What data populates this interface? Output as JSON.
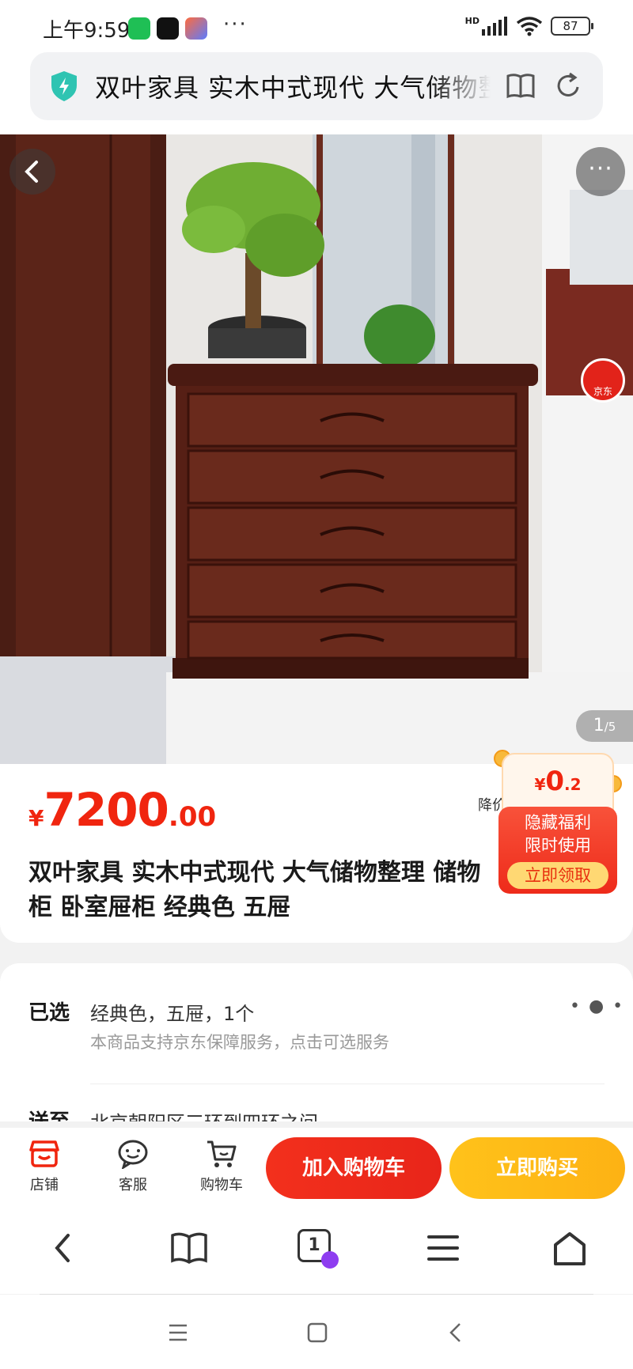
{
  "status_bar": {
    "time": "上午9:59",
    "dots": "···",
    "battery": "87",
    "network": "HD"
  },
  "url_bar": {
    "text": "双叶家具 实木中式现代 大气储物整理 储物柜 卧室屉柜 经典色 五屉"
  },
  "gallery": {
    "counter_current": "1",
    "counter_total": "/5",
    "jd_badge": "京东",
    "more_label": "···"
  },
  "product": {
    "currency": "¥",
    "price_int": "7200",
    "price_dec": ".00",
    "price_alert": "降价",
    "title": "双叶家具 实木中式现代 大气储物整理 储物柜 卧室屉柜 经典色 五屉"
  },
  "coupon": {
    "currency": "¥",
    "amount_int": "0",
    "amount_dec": ".2",
    "line1": "隐藏福利",
    "line2": "限时使用",
    "button": "立即领取"
  },
  "options": {
    "selected_label": "已选",
    "selected_value": "经典色，五屉，1个",
    "service_note": "本商品支持京东保障服务，点击可选服务",
    "ship_label": "送至",
    "ship_value": "北京朝阳区三环到四环之间"
  },
  "action_bar": {
    "shop": "店铺",
    "service": "客服",
    "cart": "购物车",
    "add_to_cart": "加入购物车",
    "buy_now": "立即购买"
  },
  "browser_nav": {
    "tab_count": "1"
  },
  "colors": {
    "accent_red": "#f0250f",
    "buy_yellow": "#ffc21a"
  }
}
